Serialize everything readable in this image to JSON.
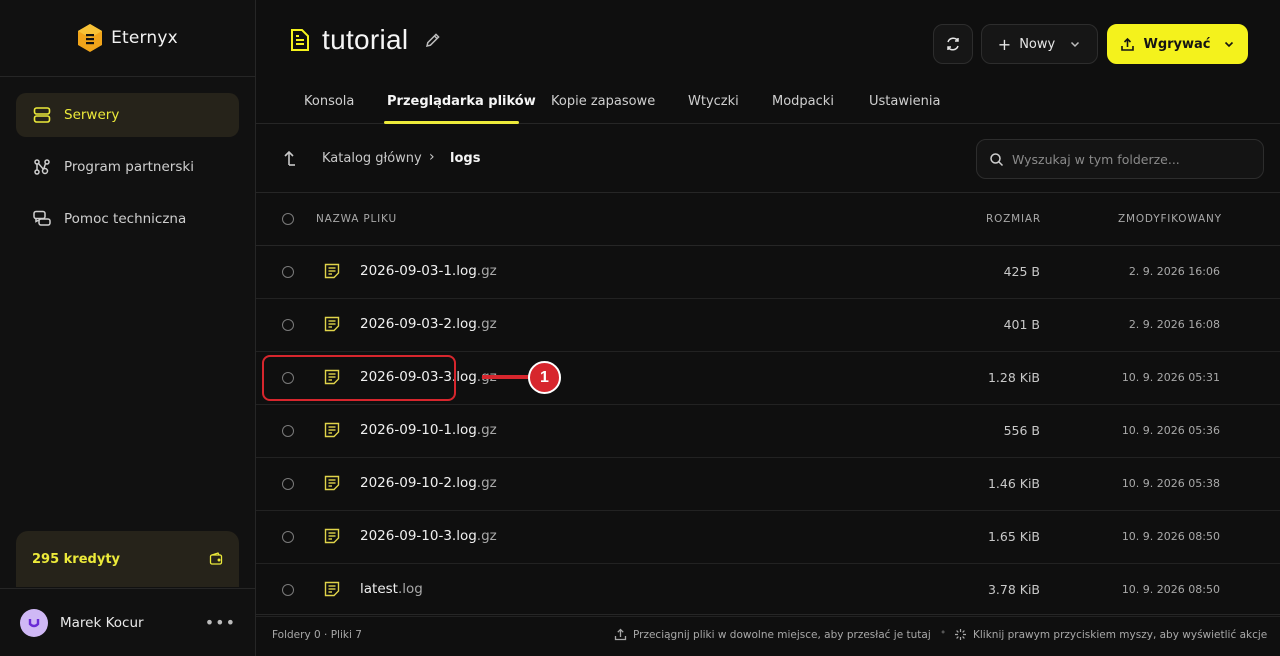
{
  "app": {
    "name": "Eternyx"
  },
  "sidebar": {
    "items": [
      {
        "label": "Serwery",
        "icon": "server-icon",
        "active": true
      },
      {
        "label": "Program partnerski",
        "icon": "share-icon",
        "active": false
      },
      {
        "label": "Pomoc techniczna",
        "icon": "chat-icon",
        "active": false
      }
    ],
    "credits": "295 kredyty",
    "user": {
      "name": "Marek Kocur"
    }
  },
  "header": {
    "title": "tutorial",
    "new_label": "Nowy",
    "upload_label": "Wgrywać"
  },
  "tabs": [
    {
      "label": "Konsola"
    },
    {
      "label": "Przeglądarka plików",
      "active": true
    },
    {
      "label": "Kopie zapasowe"
    },
    {
      "label": "Wtyczki"
    },
    {
      "label": "Modpacki"
    },
    {
      "label": "Ustawienia"
    }
  ],
  "breadcrumb": {
    "root": "Katalog główny",
    "current": "logs"
  },
  "search": {
    "placeholder": "Wyszukaj w tym folderze..."
  },
  "table": {
    "headers": {
      "name": "NAZWA PLIKU",
      "size": "ROZMIAR",
      "modified": "ZMODYFIKOWANY"
    },
    "rows": [
      {
        "base": "2026-09-03-1.log",
        "ext": ".gz",
        "size": "425 B",
        "modified": "2. 9. 2026 16:06"
      },
      {
        "base": "2026-09-03-2.log",
        "ext": ".gz",
        "size": "401 B",
        "modified": "2. 9. 2026 16:08"
      },
      {
        "base": "2026-09-03-3.log",
        "ext": ".gz",
        "size": "1.28 KiB",
        "modified": "10. 9. 2026 05:31"
      },
      {
        "base": "2026-09-10-1.log",
        "ext": ".gz",
        "size": "556 B",
        "modified": "10. 9. 2026 05:36"
      },
      {
        "base": "2026-09-10-2.log",
        "ext": ".gz",
        "size": "1.46 KiB",
        "modified": "10. 9. 2026 05:38"
      },
      {
        "base": "2026-09-10-3.log",
        "ext": ".gz",
        "size": "1.65 KiB",
        "modified": "10. 9. 2026 08:50"
      },
      {
        "base": "latest",
        "ext": ".log",
        "size": "3.78 KiB",
        "modified": "10. 9. 2026 08:50"
      }
    ]
  },
  "annotation": {
    "number": "1"
  },
  "footer": {
    "counts": "Foldery 0 · Pliki 7",
    "drag_hint": "Przeciągnij pliki w dowolne miejsce, aby przesłać je tutaj",
    "context_hint": "Kliknij prawym przyciskiem myszy, aby wyświetlić akcje"
  },
  "colors": {
    "accent": "#f4f21c",
    "annotation": "#d7262d",
    "background": "#0f0f0f"
  }
}
